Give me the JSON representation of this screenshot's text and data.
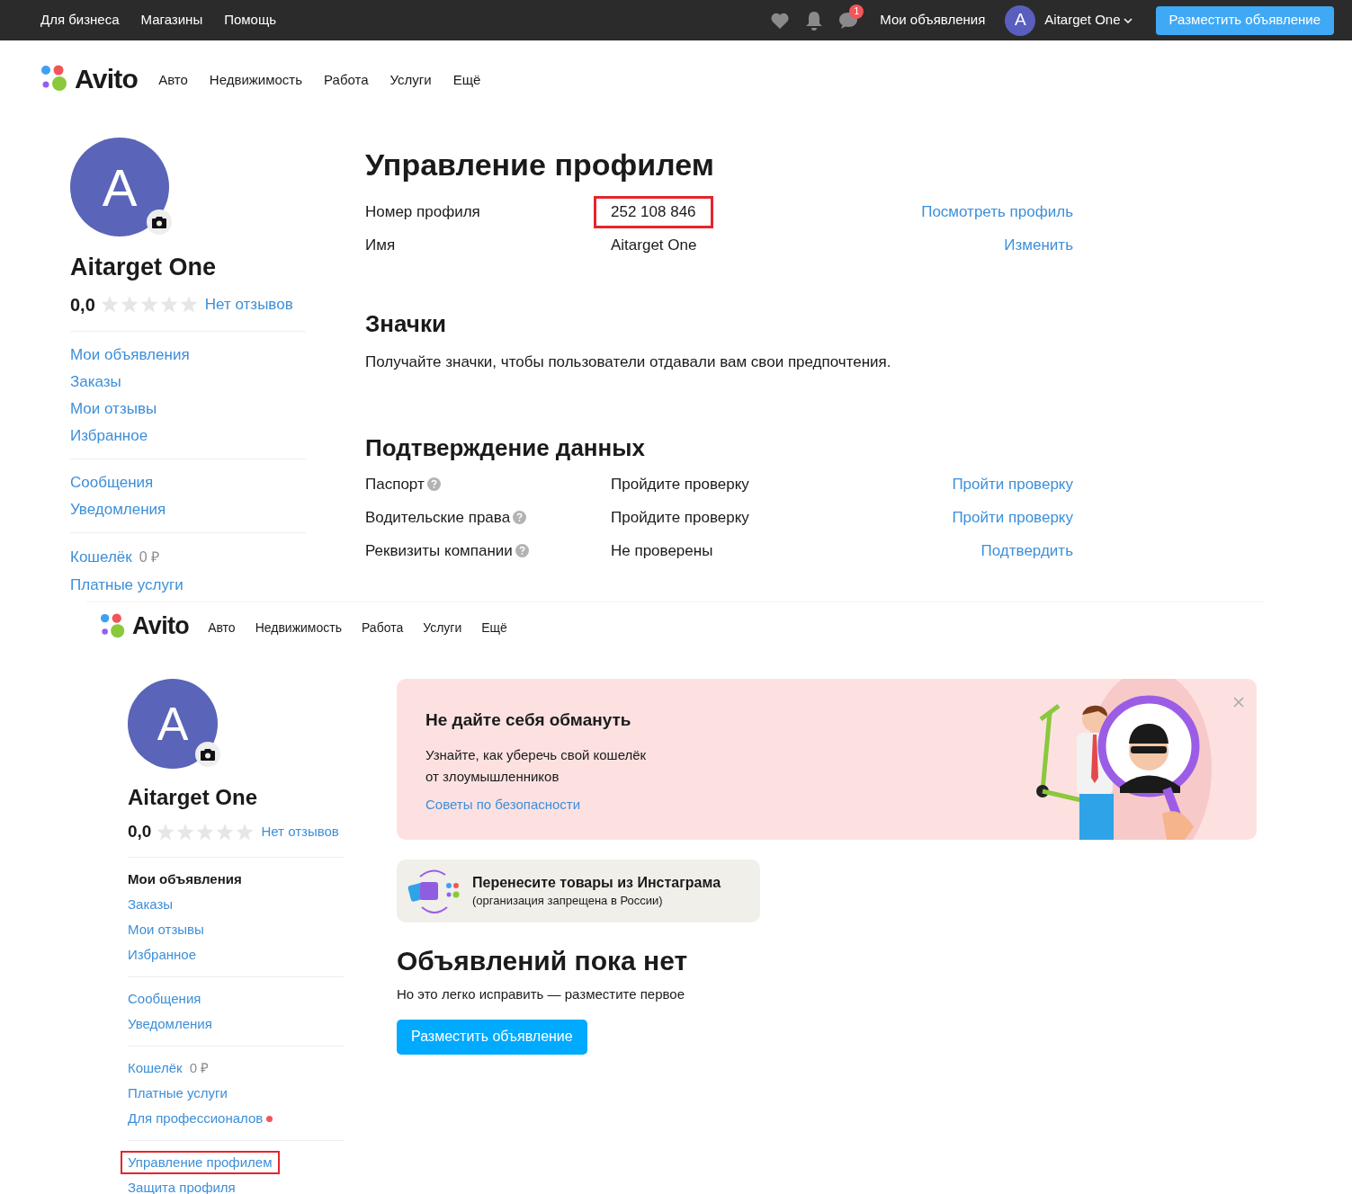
{
  "top_bar": {
    "links": [
      "Для бизнеса",
      "Магазины",
      "Помощь"
    ],
    "message_count": "1",
    "my_ads": "Мои объявления",
    "user": {
      "initial": "A",
      "name": "Aitarget One"
    },
    "post_button": "Разместить объявление"
  },
  "screen_1": {
    "header": {
      "logo": "Avito",
      "nav": [
        "Авто",
        "Недвижимость",
        "Работа",
        "Услуги",
        "Ещё"
      ]
    },
    "sidebar": {
      "initial": "A",
      "name": "Aitarget One",
      "rating": "0,0",
      "stars": 0,
      "reviews_link": "Нет отзывов",
      "groups": [
        [
          {
            "label": "Мои объявления"
          },
          {
            "label": "Заказы"
          },
          {
            "label": "Мои отзывы"
          },
          {
            "label": "Избранное"
          }
        ],
        [
          {
            "label": "Сообщения"
          },
          {
            "label": "Уведомления"
          }
        ],
        [
          {
            "label": "Кошелёк",
            "value": "0 ₽"
          },
          {
            "label": "Платные услуги"
          }
        ]
      ]
    },
    "title": "Управление профилем",
    "profile_rows": [
      {
        "label": "Номер профиля",
        "value": "252 108 846",
        "action": "Посмотреть профиль",
        "highlighted": true
      },
      {
        "label": "Имя",
        "value": "Aitarget One",
        "action": "Изменить",
        "highlighted": false
      }
    ],
    "badges": {
      "title": "Значки",
      "text": "Получайте значки, чтобы пользователи отдавали вам свои предпочтения."
    },
    "verification": {
      "title": "Подтверждение данных",
      "rows": [
        {
          "label": "Паспорт",
          "status": "Пройдите проверку",
          "action": "Пройти проверку"
        },
        {
          "label": "Водительские права",
          "status": "Пройдите проверку",
          "action": "Пройти проверку"
        },
        {
          "label": "Реквизиты компании",
          "status": "Не проверены",
          "action": "Подтвердить"
        }
      ]
    }
  },
  "screen_2": {
    "header": {
      "logo": "Avito",
      "nav": [
        "Авто",
        "Недвижимость",
        "Работа",
        "Услуги",
        "Ещё"
      ]
    },
    "sidebar": {
      "initial": "A",
      "name": "Aitarget One",
      "rating": "0,0",
      "stars": 0,
      "reviews_link": "Нет отзывов",
      "groups": [
        [
          {
            "label": "Мои объявления",
            "selected": true,
            "highlighted": false
          },
          {
            "label": "Заказы",
            "selected": false,
            "highlighted": false
          },
          {
            "label": "Мои отзывы",
            "selected": false,
            "highlighted": false
          },
          {
            "label": "Избранное",
            "selected": false,
            "highlighted": false
          }
        ],
        [
          {
            "label": "Сообщения",
            "selected": false,
            "highlighted": false
          },
          {
            "label": "Уведомления",
            "selected": false,
            "highlighted": false
          }
        ],
        [
          {
            "label": "Кошелёк",
            "value": "0 ₽",
            "selected": false,
            "highlighted": false
          },
          {
            "label": "Платные услуги",
            "selected": false,
            "highlighted": false
          },
          {
            "label": "Для профессионалов",
            "dot": true,
            "selected": false,
            "highlighted": false
          }
        ],
        [
          {
            "label": "Управление профилем",
            "selected": false,
            "highlighted": true
          },
          {
            "label": "Защита профиля",
            "selected": false,
            "highlighted": false
          }
        ]
      ]
    },
    "banner": {
      "title": "Не дайте себя обмануть",
      "text": "Узнайте, как уберечь свой кошелёк",
      "text_2": "от злоумышленников",
      "link": "Советы по безопасности"
    },
    "import_card": {
      "title": "Перенесите товары из Инстаграма",
      "note": "(организация запрещена в России)"
    },
    "empty": {
      "title": "Объявлений пока нет",
      "text": "Но это легко исправить — разместите первое",
      "button": "Разместить объявление"
    }
  }
}
